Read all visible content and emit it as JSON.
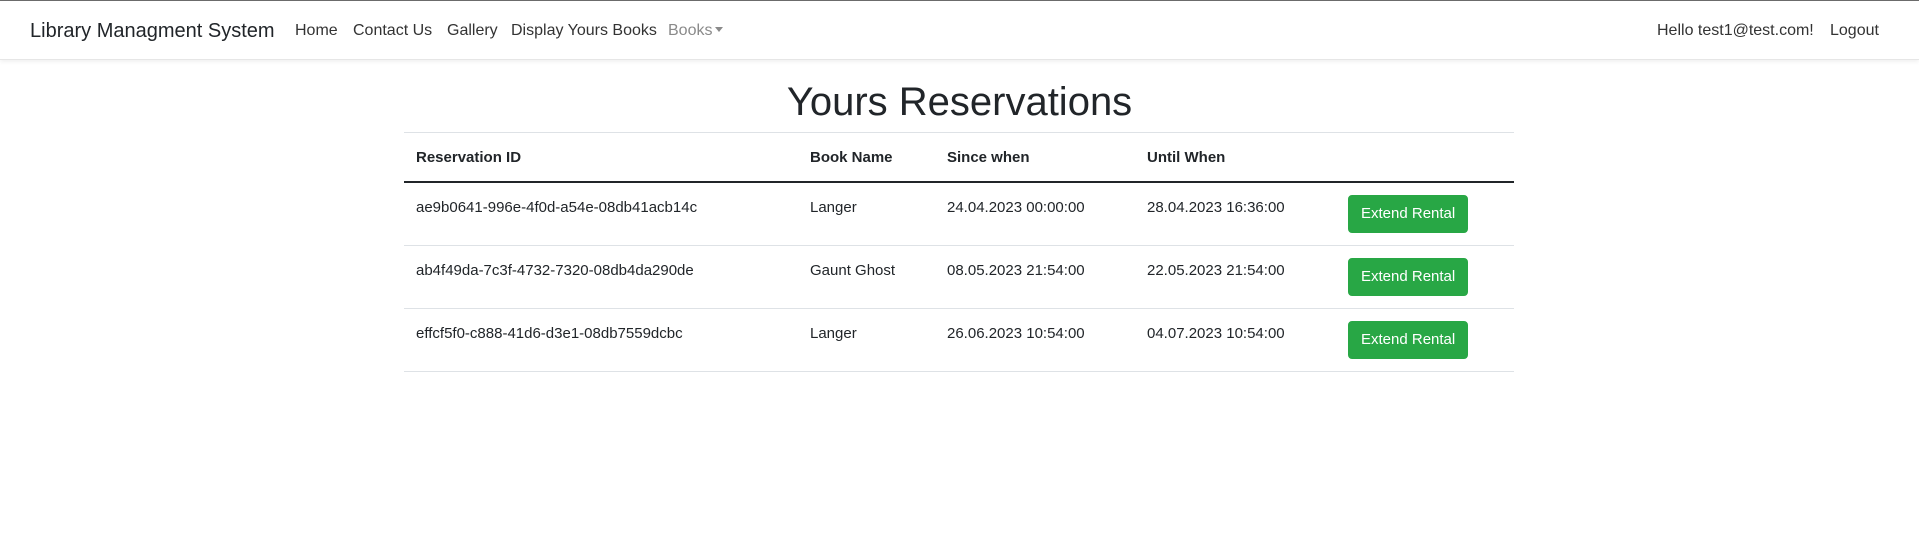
{
  "navbar": {
    "brand": "Library Managment System",
    "links": [
      {
        "label": "Home"
      },
      {
        "label": "Contact Us"
      },
      {
        "label": "Gallery"
      },
      {
        "label": "Display Yours Books"
      },
      {
        "label": "Books"
      }
    ],
    "greeting": "Hello test1@test.com!",
    "logout": "Logout"
  },
  "page": {
    "title": "Yours Reservations"
  },
  "table": {
    "headers": [
      "Reservation ID",
      "Book Name",
      "Since when",
      "Until When",
      ""
    ],
    "rows": [
      {
        "id": "ae9b0641-996e-4f0d-a54e-08db41acb14c",
        "book": "Langer",
        "since": "24.04.2023 00:00:00",
        "until": "28.04.2023 16:36:00",
        "action": "Extend Rental"
      },
      {
        "id": "ab4f49da-7c3f-4732-7320-08db4da290de",
        "book": "Gaunt Ghost",
        "since": "08.05.2023 21:54:00",
        "until": "22.05.2023 21:54:00",
        "action": "Extend Rental"
      },
      {
        "id": "effcf5f0-c888-41d6-d3e1-08db7559dcbc",
        "book": "Langer",
        "since": "26.06.2023 10:54:00",
        "until": "04.07.2023 10:54:00",
        "action": "Extend Rental"
      }
    ]
  },
  "colors": {
    "success": "#28a745",
    "text": "#212529",
    "muted_link": "#8a8a8a"
  }
}
